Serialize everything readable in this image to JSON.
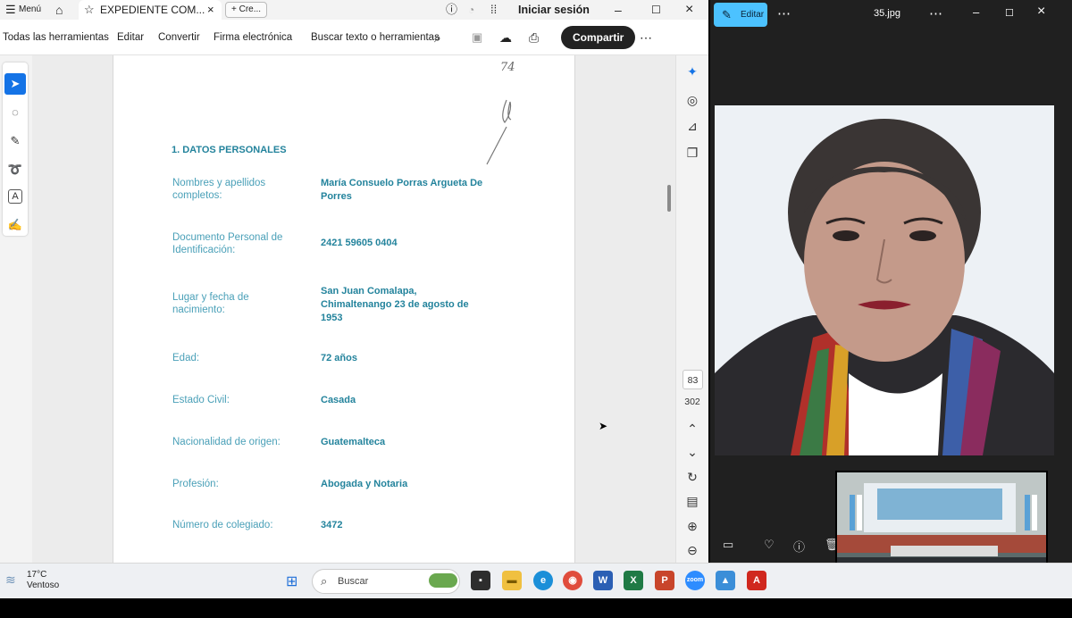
{
  "acrobat": {
    "menu_label": "Menú",
    "tab_title": "EXPEDIENTE COM...",
    "new_tab_label": "+ Cre...",
    "signin_label": "Iniciar sesión",
    "toolbar": {
      "all_tools": "Todas las herramientas",
      "edit": "Editar",
      "convert": "Convertir",
      "esign": "Firma electrónica",
      "search": "Buscar texto o herramientas",
      "share": "Compartir"
    },
    "page_current": "83",
    "page_total": "302"
  },
  "document": {
    "margin_number": "74",
    "section_title": "1.  DATOS PERSONALES",
    "fields": [
      {
        "label": "Nombres y apellidos completos:",
        "value": "María Consuelo Porras Argueta De Porres"
      },
      {
        "label": "Documento Personal de Identificación:",
        "value": "2421 59605 0404"
      },
      {
        "label": "Lugar y fecha de nacimiento:",
        "value": "San Juan Comalapa, Chimaltenango 23 de agosto de 1953"
      },
      {
        "label": "Edad:",
        "value": "72 años"
      },
      {
        "label": "Estado Civil:",
        "value": "Casada"
      },
      {
        "label": "Nacionalidad de origen:",
        "value": "Guatemalteca"
      },
      {
        "label": "Profesión:",
        "value": "Abogada y Notaria"
      },
      {
        "label": "Número de colegiado:",
        "value": "3472"
      }
    ]
  },
  "photos": {
    "edit_label": "Editar",
    "file_name": "35.jpg"
  },
  "taskbar": {
    "temperature": "17°C",
    "condition": "Ventoso",
    "search_placeholder": "Buscar",
    "apps": [
      "files-icon",
      "edge-icon",
      "chrome-icon",
      "word-icon",
      "excel-icon",
      "powerpoint-icon",
      "zoom-icon",
      "photos-icon",
      "acrobat-icon"
    ]
  },
  "colors": {
    "doc_teal": "#23839c",
    "acrobat_blue": "#1473e6",
    "photos_accent": "#4cc2ff"
  }
}
